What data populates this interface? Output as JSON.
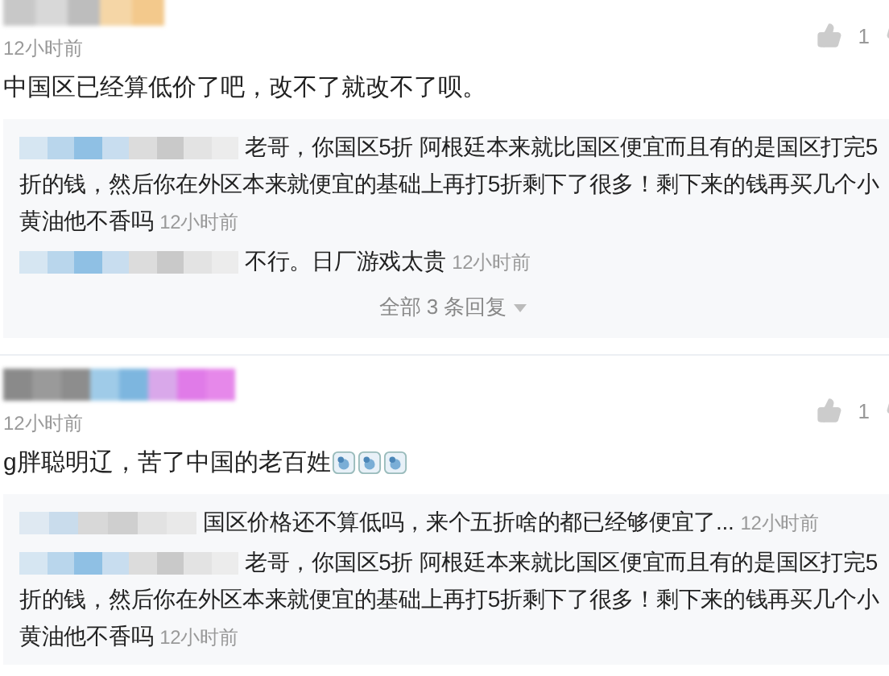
{
  "comments": [
    {
      "time": "12小时前",
      "likes": "1",
      "text": "中国区已经算低价了吧，改不了就改不了呗。",
      "replies": [
        {
          "text": "老哥，你国区5折 阿根廷本来就比国区便宜而且有的是国区打完5折的钱，然后你在外区本来就便宜的基础上再打5折剩下了很多！剩下来的钱再买几个小黄油他不香吗",
          "time": "12小时前"
        },
        {
          "text": "不行。日厂游戏太贵",
          "time": "12小时前"
        }
      ],
      "more_replies": "全部 3 条回复"
    },
    {
      "time": "12小时前",
      "likes": "1",
      "text": "g胖聪明辽，苦了中国的老百姓",
      "emoji": [
        {
          "kind": "doge"
        },
        {
          "kind": "doge"
        },
        {
          "kind": "doge"
        }
      ],
      "replies": [
        {
          "text": "国区价格还不算低吗，来个五折啥的都已经够便宜了...",
          "time": "12小时前"
        },
        {
          "text": "老哥，你国区5折 阿根廷本来就比国区便宜而且有的是国区打完5折的钱，然后你在外区本来就便宜的基础上再打5折剩下了很多！剩下来的钱再买几个小黄油他不香吗",
          "time": "12小时前"
        }
      ]
    }
  ]
}
